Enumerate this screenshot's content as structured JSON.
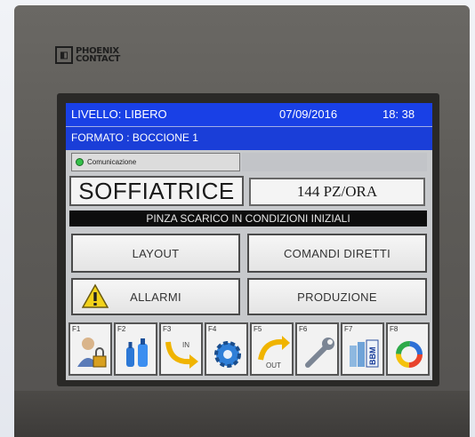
{
  "device": {
    "brand_line1": "PHOENIX",
    "brand_line2": "CONTACT"
  },
  "header": {
    "livello": "LIVELLO: LIBERO",
    "date": "07/09/2016",
    "time": "18: 38",
    "formato": "FORMATO :   BOCCIONE 1"
  },
  "communication": {
    "label": "Comunicazione",
    "status_color": "#35c04a"
  },
  "machine_name": "SOFFIATRICE",
  "production_rate": "144 PZ/ORA",
  "status_message": "PINZA SCARICO IN CONDIZIONI INIZIALI",
  "buttons": {
    "layout": "LAYOUT",
    "comandi": "COMANDI DIRETTI",
    "allarmi": "ALLARMI",
    "produzione": "PRODUZIONE"
  },
  "function_keys": [
    {
      "label": "F1",
      "icon": "user-lock-icon"
    },
    {
      "label": "F2",
      "icon": "bottles-icon"
    },
    {
      "label": "F3",
      "icon": "in-arrow-icon",
      "text": "IN"
    },
    {
      "label": "F4",
      "icon": "gear-icon"
    },
    {
      "label": "F5",
      "icon": "out-arrow-icon",
      "text": "OUT"
    },
    {
      "label": "F6",
      "icon": "wrench-icon"
    },
    {
      "label": "F7",
      "icon": "bbm-icon",
      "text": "BBM"
    },
    {
      "label": "F8",
      "icon": "color-ring-icon"
    }
  ],
  "colors": {
    "header_blue": "#1940e6",
    "panel_grey": "#c7c9cc",
    "status_bar": "#0d0d0d"
  }
}
